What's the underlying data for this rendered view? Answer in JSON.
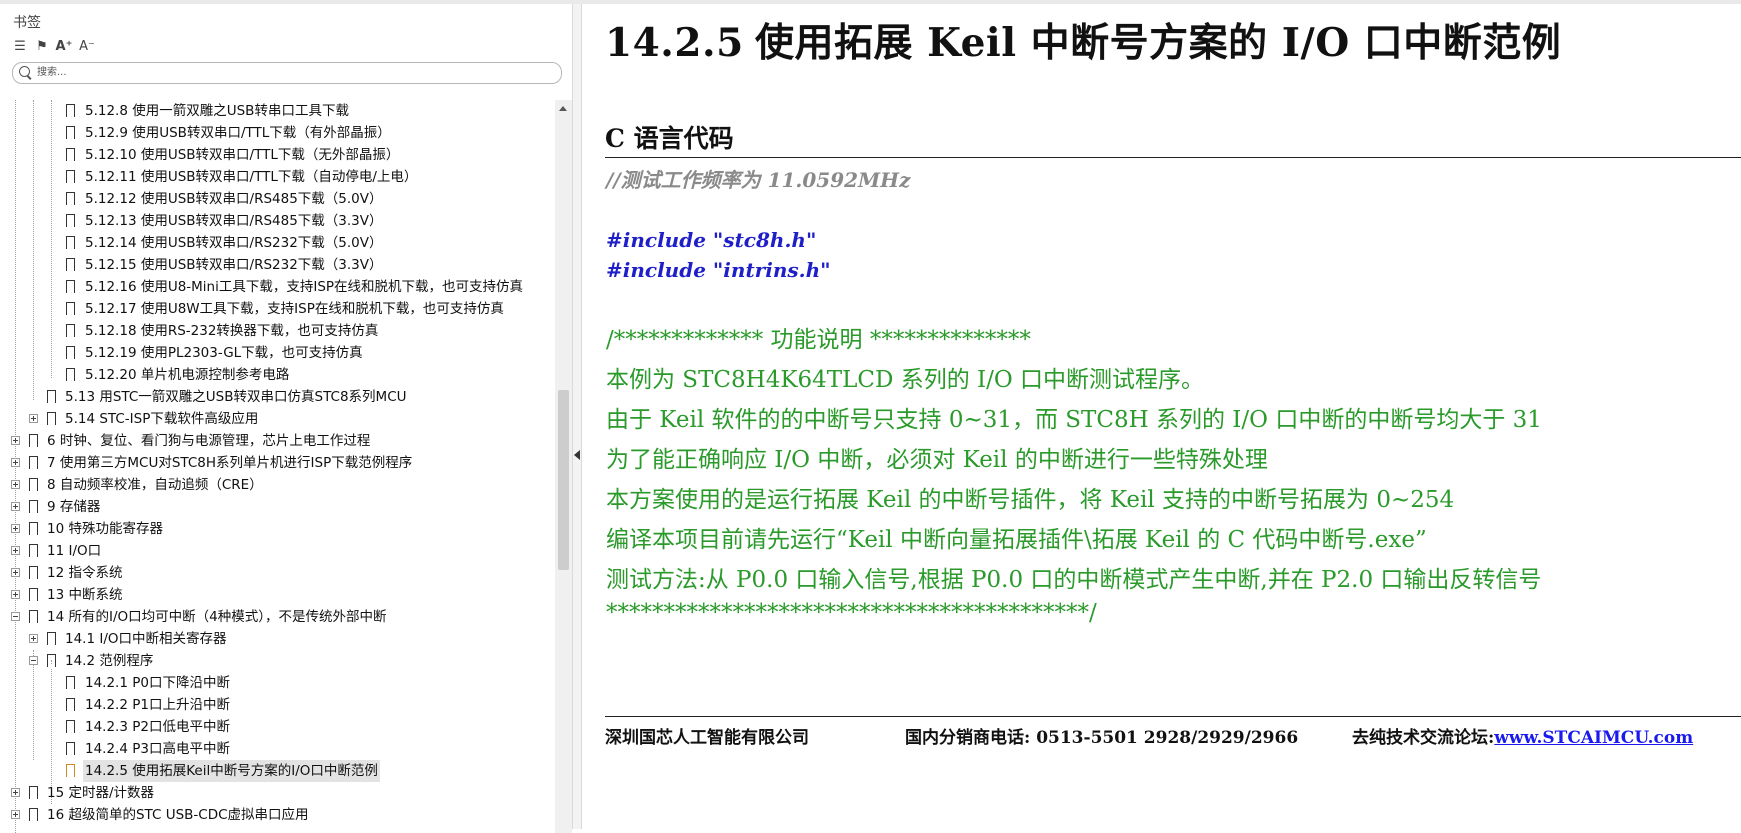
{
  "sidebar": {
    "title": "书签",
    "search_placeholder": "搜索...",
    "items": [
      {
        "label": "5.12.8  使用一箭双雕之USB转串口工具下载"
      },
      {
        "label": "5.12.9  使用USB转双串口/TTL下载（有外部晶振）"
      },
      {
        "label": "5.12.10  使用USB转双串口/TTL下载（无外部晶振）"
      },
      {
        "label": "5.12.11  使用USB转双串口/TTL下载（自动停电/上电）"
      },
      {
        "label": "5.12.12  使用USB转双串口/RS485下载（5.0V）"
      },
      {
        "label": "5.12.13 使用USB转双串口/RS485下载（3.3V）"
      },
      {
        "label": "5.12.14  使用USB转双串口/RS232下载（5.0V）"
      },
      {
        "label": "5.12.15 使用USB转双串口/RS232下载（3.3V）"
      },
      {
        "label": "5.12.16  使用U8-Mini工具下载，支持ISP在线和脱机下载，也可支持仿真"
      },
      {
        "label": "5.12.17  使用U8W工具下载，支持ISP在线和脱机下载，也可支持仿真"
      },
      {
        "label": "5.12.18  使用RS-232转换器下载，也可支持仿真"
      },
      {
        "label": "5.12.19  使用PL2303-GL下载，也可支持仿真"
      },
      {
        "label": "5.12.20  单片机电源控制参考电路"
      },
      {
        "label": "5.13  用STC一箭双雕之USB转双串口仿真STC8系列MCU"
      },
      {
        "label": "5.14  STC-ISP下载软件高级应用"
      },
      {
        "label": "6  时钟、复位、看门狗与电源管理，芯片上电工作过程"
      },
      {
        "label": "7  使用第三方MCU对STC8H系列单片机进行ISP下载范例程序"
      },
      {
        "label": "8  自动频率校准，自动追频（CRE）"
      },
      {
        "label": "9  存储器"
      },
      {
        "label": "10  特殊功能寄存器"
      },
      {
        "label": "11  I/O口"
      },
      {
        "label": "12  指令系统"
      },
      {
        "label": "13  中断系统"
      },
      {
        "label": "14  所有的I/O口均可中断（4种模式），不是传统外部中断"
      },
      {
        "label": "14.1  I/O口中断相关寄存器"
      },
      {
        "label": "14.2  范例程序"
      },
      {
        "label": "14.2.1 P0口下降沿中断"
      },
      {
        "label": "14.2.2 P1口上升沿中断"
      },
      {
        "label": "14.2.3 P2口低电平中断"
      },
      {
        "label": "14.2.4 P3口高电平中断"
      },
      {
        "label": "14.2.5 使用拓展Keil中断号方案的I/O口中断范例"
      },
      {
        "label": "15  定时器/计数器"
      },
      {
        "label": "16  超级简单的STC USB-CDC虚拟串口应用"
      }
    ]
  },
  "doc": {
    "section_number": "14.2.5",
    "section_title": "使用拓展 Keil 中断号方案的 I/O 口中断范例",
    "subheading": "C 语言代码",
    "code_lines": [
      "//测试工作频率为 11.0592MHz",
      "#include \"stc8h.h\"",
      "#include \"intrins.h\"",
      "/*************     功能说明        **************",
      "本例为 STC8H4K64TLCD 系列的 I/O 口中断测试程序。",
      "由于 Keil 软件的的中断号只支持 0~31，而 STC8H 系列的 I/O 口中断的中断号均大于 31",
      "为了能正确响应 I/O 中断，必须对 Keil 的中断进行一些特殊处理",
      "本方案使用的是运行拓展 Keil 的中断号插件，将 Keil 支持的中断号拓展为 0~254",
      "编译本项目前请先运行“Keil 中断向量拓展插件\\拓展 Keil 的 C 代码中断号.exe”",
      "测试方法:从 P0.0 口输入信号,根据 P0.0 口的中断模式产生中断,并在 P2.0 口输出反转信号",
      "******************************************/"
    ],
    "footer": {
      "company": "深圳国芯人工智能有限公司",
      "phone": "国内分销商电话: 0513-5501 2928/2929/2966",
      "forum_label": "去纯技术交流论坛:",
      "forum_link": "www.STCAIMCU.com"
    }
  }
}
